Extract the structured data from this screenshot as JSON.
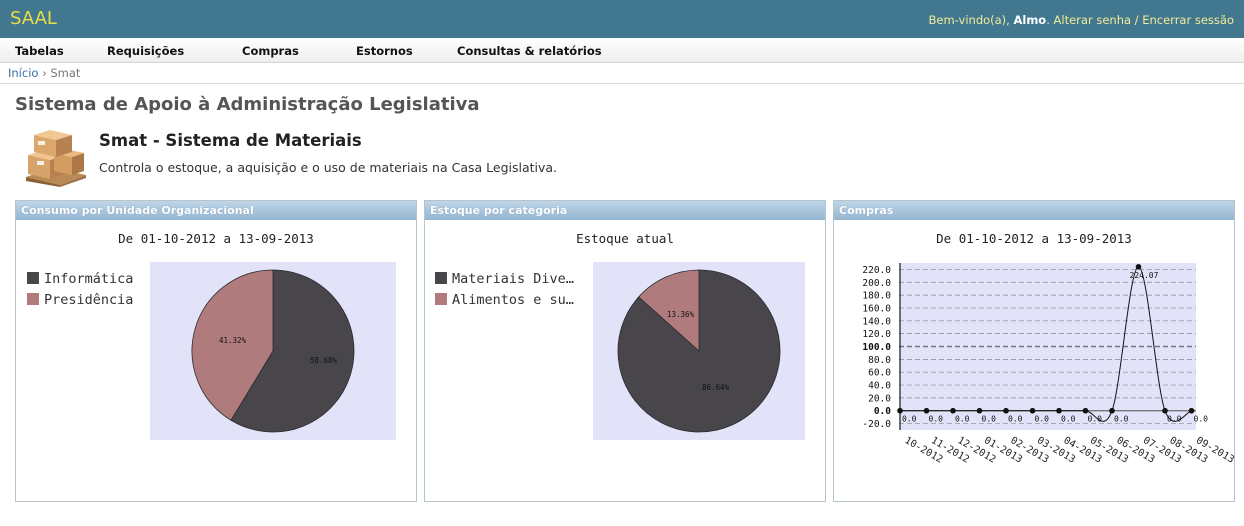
{
  "header": {
    "brand": "SAAL",
    "welcome_prefix": "Bem-vindo(a), ",
    "user": "Almo",
    "after_user": ". ",
    "change_password": "Alterar senha",
    "sep": " / ",
    "logout": "Encerrar sessão"
  },
  "menu": [
    "Tabelas",
    "Requisições",
    "Compras",
    "Estornos",
    "Consultas & relatórios"
  ],
  "breadcrumb": {
    "home": "Início",
    "separator": " › ",
    "current": "Smat"
  },
  "page": {
    "title": "Sistema de Apoio à Administração Legislativa",
    "app_title": "Smat - Sistema de Materiais",
    "app_description": "Controla o estoque, a aquisição e o uso de materiais na Casa Legislativa."
  },
  "panels": {
    "consumo": {
      "title": "Consumo por Unidade Organizacional",
      "subtitle": "De 01-10-2012 a 13-09-2013"
    },
    "estoque": {
      "title": "Estoque por categoria",
      "subtitle": "Estoque atual"
    },
    "compras": {
      "title": "Compras",
      "subtitle": "De 01-10-2012 a 13-09-2013"
    }
  },
  "colors": {
    "dark": "#48464b",
    "rose": "#b07b7c",
    "plot_bg": "#e2e2f9",
    "header_bar": "#41788f",
    "brand": "#ecdc45"
  },
  "chart_data": [
    {
      "type": "pie",
      "subtitle": "De 01-10-2012 a 13-09-2013",
      "legend": [
        "Informática",
        "Presidência"
      ],
      "slice_labels": [
        "58.68%",
        "41.32%"
      ],
      "values": [
        58.68,
        41.32
      ],
      "colors": [
        "#48464b",
        "#b07b7c"
      ]
    },
    {
      "type": "pie",
      "subtitle": "Estoque atual",
      "legend": [
        "Materiais Dive…",
        "Alimentos e su…"
      ],
      "slice_labels": [
        "86.64%",
        "13.36%"
      ],
      "values": [
        86.64,
        13.36
      ],
      "colors": [
        "#48464b",
        "#b07b7c"
      ]
    },
    {
      "type": "line",
      "subtitle": "De 01-10-2012 a 13-09-2013",
      "categories": [
        "10-2012",
        "11-2012",
        "12-2012",
        "01-2013",
        "02-2013",
        "03-2013",
        "04-2013",
        "05-2013",
        "06-2013",
        "07-2013",
        "08-2013",
        "09-2013"
      ],
      "values": [
        0,
        0,
        0,
        0,
        0,
        0,
        0,
        0,
        0,
        224.07,
        0,
        0
      ],
      "point_labels": [
        "0.0",
        "0.0",
        "0.0",
        "0.0",
        "0.0",
        "0.0",
        "0.0",
        "0.0",
        "0.0",
        "224.07",
        "0.0",
        "0.0"
      ],
      "yticks": [
        "220.0",
        "200.0",
        "180.0",
        "160.0",
        "140.0",
        "120.0",
        "100.0",
        "80.0",
        "60.0",
        "40.0",
        "20.0",
        "0.0",
        "-20.0"
      ],
      "ylim": [
        -30,
        230
      ],
      "grid": true
    }
  ]
}
